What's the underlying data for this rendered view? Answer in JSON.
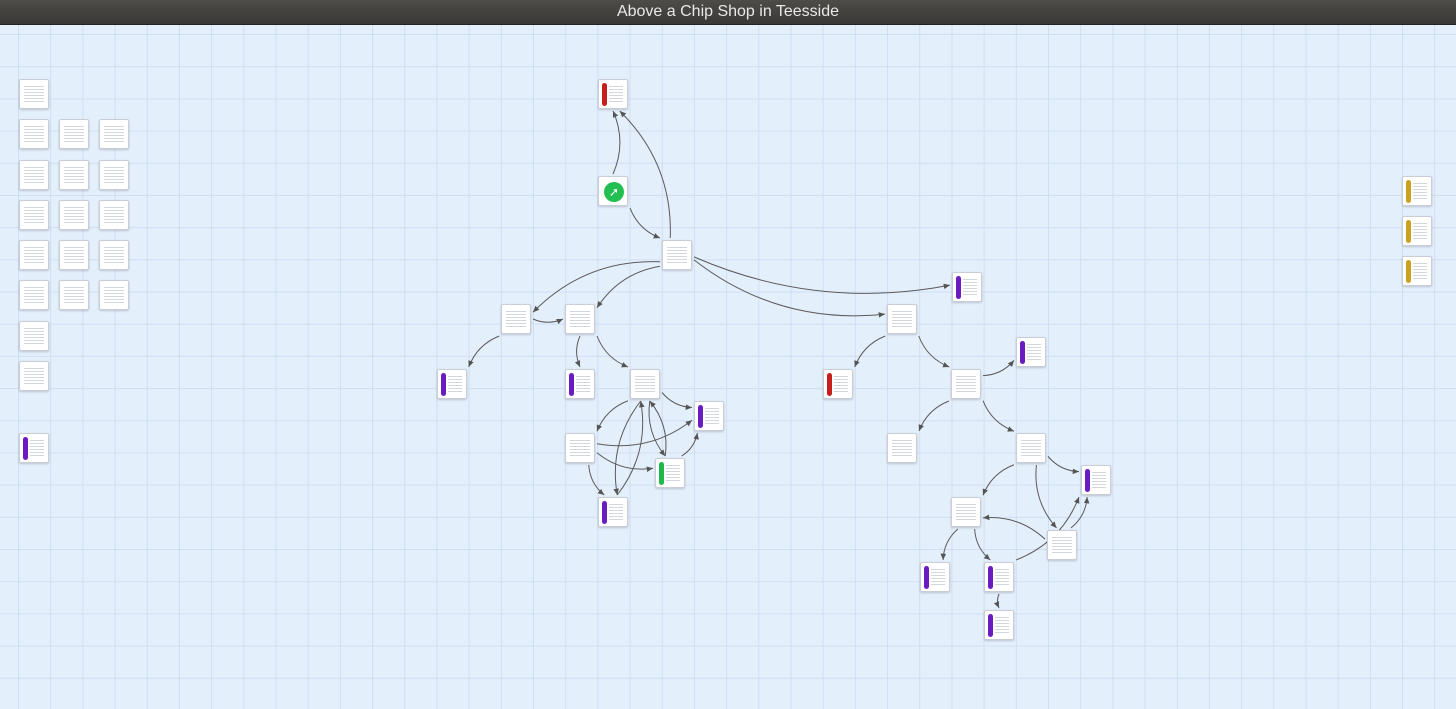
{
  "window": {
    "title": "Above a Chip Shop in Teesside"
  },
  "colors": {
    "purple": "#6a1bc2",
    "red": "#c81d1d",
    "green": "#1fb84a",
    "yellow": "#c9a21f",
    "start": "#23bf52"
  },
  "start_icon": {
    "name": "rocket-icon",
    "glyph": "🚀"
  },
  "cards": [
    {
      "id": "l1",
      "tag": null
    },
    {
      "id": "l2",
      "tag": null
    },
    {
      "id": "l3",
      "tag": null
    },
    {
      "id": "l4",
      "tag": null
    },
    {
      "id": "l5",
      "tag": null
    },
    {
      "id": "l6",
      "tag": null
    },
    {
      "id": "l7",
      "tag": null
    },
    {
      "id": "l8",
      "tag": null
    },
    {
      "id": "l9",
      "tag": null
    },
    {
      "id": "l10",
      "tag": null
    },
    {
      "id": "l11",
      "tag": null
    },
    {
      "id": "l12",
      "tag": null
    },
    {
      "id": "l13",
      "tag": null
    },
    {
      "id": "l14",
      "tag": null
    },
    {
      "id": "l15",
      "tag": null
    },
    {
      "id": "l16",
      "tag": null
    },
    {
      "id": "l17",
      "tag": null
    },
    {
      "id": "l18",
      "tag": null
    },
    {
      "id": "l19",
      "tag": "purple"
    },
    {
      "id": "top",
      "tag": "red"
    },
    {
      "id": "start",
      "tag": "start"
    },
    {
      "id": "hub",
      "tag": null
    },
    {
      "id": "hubR",
      "tag": "purple"
    },
    {
      "id": "a",
      "tag": null
    },
    {
      "id": "b",
      "tag": null
    },
    {
      "id": "a1",
      "tag": "purple"
    },
    {
      "id": "b1",
      "tag": "purple"
    },
    {
      "id": "b2",
      "tag": null
    },
    {
      "id": "b3",
      "tag": "purple"
    },
    {
      "id": "c1",
      "tag": null
    },
    {
      "id": "c2",
      "tag": "green"
    },
    {
      "id": "c3",
      "tag": "purple"
    },
    {
      "id": "r",
      "tag": null
    },
    {
      "id": "r1",
      "tag": "red"
    },
    {
      "id": "r2",
      "tag": null
    },
    {
      "id": "r3",
      "tag": "purple"
    },
    {
      "id": "r4",
      "tag": null
    },
    {
      "id": "r5",
      "tag": null
    },
    {
      "id": "r6",
      "tag": "purple"
    },
    {
      "id": "r7",
      "tag": null
    },
    {
      "id": "r8",
      "tag": null
    },
    {
      "id": "r9",
      "tag": "purple"
    },
    {
      "id": "r10",
      "tag": "purple"
    },
    {
      "id": "r11",
      "tag": "purple"
    },
    {
      "id": "y1",
      "tag": "yellow"
    },
    {
      "id": "y2",
      "tag": "yellow"
    },
    {
      "id": "y3",
      "tag": "yellow"
    }
  ],
  "links": [
    {
      "from": "start",
      "to": "top"
    },
    {
      "from": "start",
      "to": "hub"
    },
    {
      "from": "hub",
      "to": "top"
    },
    {
      "from": "hub",
      "to": "a"
    },
    {
      "from": "hub",
      "to": "b"
    },
    {
      "from": "hub",
      "to": "r"
    },
    {
      "from": "hub",
      "to": "hubR"
    },
    {
      "from": "a",
      "to": "b"
    },
    {
      "from": "a",
      "to": "a1"
    },
    {
      "from": "b",
      "to": "b1"
    },
    {
      "from": "b",
      "to": "b2"
    },
    {
      "from": "b2",
      "to": "b3"
    },
    {
      "from": "b2",
      "to": "c1"
    },
    {
      "from": "b2",
      "to": "c2"
    },
    {
      "from": "b2",
      "to": "c3"
    },
    {
      "from": "c1",
      "to": "b3"
    },
    {
      "from": "c1",
      "to": "c2"
    },
    {
      "from": "c1",
      "to": "c3"
    },
    {
      "from": "c2",
      "to": "b3"
    },
    {
      "from": "c2",
      "to": "b2"
    },
    {
      "from": "c3",
      "to": "b2"
    },
    {
      "from": "r",
      "to": "r1"
    },
    {
      "from": "r",
      "to": "r2"
    },
    {
      "from": "r2",
      "to": "r3"
    },
    {
      "from": "r2",
      "to": "r4"
    },
    {
      "from": "r2",
      "to": "r5"
    },
    {
      "from": "r5",
      "to": "r6"
    },
    {
      "from": "r5",
      "to": "r7"
    },
    {
      "from": "r5",
      "to": "r8"
    },
    {
      "from": "r8",
      "to": "r6"
    },
    {
      "from": "r8",
      "to": "r7"
    },
    {
      "from": "r7",
      "to": "r9"
    },
    {
      "from": "r7",
      "to": "r10"
    },
    {
      "from": "r10",
      "to": "r6"
    },
    {
      "from": "r10",
      "to": "r11"
    }
  ]
}
